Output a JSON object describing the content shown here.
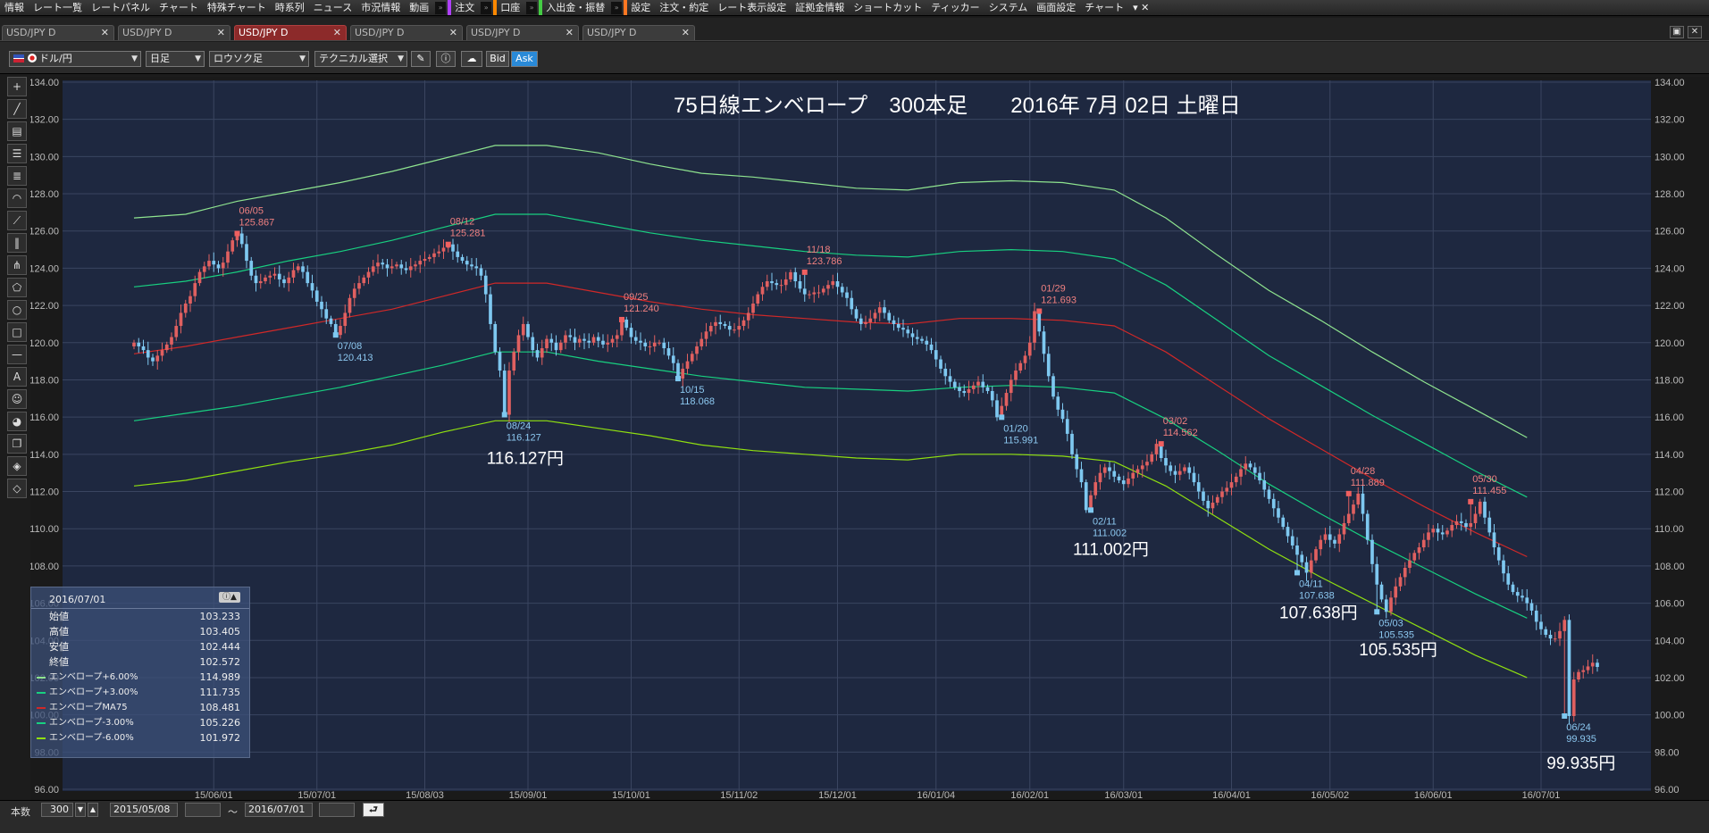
{
  "menu": {
    "items_left": [
      "情報",
      "レート一覧",
      "レートパネル",
      "チャート",
      "特殊チャート",
      "時系列",
      "ニュース",
      "市況情報",
      "動画"
    ],
    "order": "注文",
    "account": "口座",
    "deposit": "入出金・振替",
    "items_right": [
      "設定",
      "注文・約定",
      "レート表示設定",
      "証拠金情報",
      "ショートカット",
      "ティッカー",
      "システム",
      "画面設定",
      "チャート"
    ],
    "colors": {
      "order": "#b040ff",
      "account": "#ff8800",
      "deposit": "#44cc44",
      "settings": "#ff7722"
    }
  },
  "tabs": [
    {
      "label": "USD/JPY D",
      "active": false
    },
    {
      "label": "USD/JPY D",
      "active": false
    },
    {
      "label": "USD/JPY D",
      "active": true
    },
    {
      "label": "USD/JPY D",
      "active": false
    },
    {
      "label": "USD/JPY D",
      "active": false
    },
    {
      "label": "USD/JPY D",
      "active": false
    }
  ],
  "toolbar": {
    "pair": "ドル/円",
    "period": "日足",
    "chart_style": "ロウソク足",
    "technical": "テクニカル選択",
    "bid": "Bid",
    "ask": "Ask"
  },
  "legend": {
    "date": "2016/07/01",
    "ohlc": [
      {
        "label": "始値",
        "value": "103.233"
      },
      {
        "label": "高値",
        "value": "103.405"
      },
      {
        "label": "安値",
        "value": "102.444"
      },
      {
        "label": "終値",
        "value": "102.572"
      }
    ],
    "envelopes": [
      {
        "label": "エンベロープ+6.00%",
        "value": "114.989",
        "color": "#8fe48f"
      },
      {
        "label": "エンベロープ+3.00%",
        "value": "111.735",
        "color": "#18d080"
      },
      {
        "label": "エンベロープMA75",
        "value": "108.481",
        "color": "#d02828"
      },
      {
        "label": "エンベロープ-3.00%",
        "value": "105.226",
        "color": "#18d080"
      },
      {
        "label": "エンベロープ-6.00%",
        "value": "101.972",
        "color": "#90e010"
      }
    ]
  },
  "bottom": {
    "bars_label": "本数",
    "bars_value": "300",
    "from": "2015/05/08",
    "tilde": "～",
    "to": "2016/07/01"
  },
  "chart_data": {
    "type": "candlestick",
    "title": "75日線エンベロープ　300本足　　2016年 7月 02日 土曜日",
    "ylim": [
      96,
      134
    ],
    "y_ticks": [
      "96.00",
      "98.00",
      "100.00",
      "102.00",
      "104.00",
      "106.00",
      "108.00",
      "110.00",
      "112.00",
      "114.00",
      "116.00",
      "118.00",
      "120.00",
      "122.00",
      "124.00",
      "126.00",
      "128.00",
      "130.00",
      "132.00",
      "134.00"
    ],
    "x_ticks": [
      "15/06/01",
      "15/07/01",
      "15/08/03",
      "15/09/01",
      "15/10/01",
      "15/11/02",
      "15/12/01",
      "16/01/04",
      "16/02/01",
      "16/03/01",
      "16/04/01",
      "16/05/02",
      "16/06/01",
      "16/07/01"
    ],
    "x_tick_index": [
      17,
      39,
      62,
      84,
      106,
      129,
      150,
      171,
      191,
      211,
      234,
      255,
      277,
      300
    ],
    "colors": {
      "up": "#e06060",
      "down": "#7ec8f0",
      "high_label": "#f08080",
      "low_label": "#8cc8f0",
      "bg": "#1e2840",
      "grid": "#3a4560"
    },
    "closes": [
      120.0,
      119.8,
      119.6,
      119.2,
      119.0,
      119.3,
      119.6,
      119.9,
      120.3,
      120.9,
      121.6,
      122.1,
      122.5,
      123.2,
      123.8,
      124.1,
      124.4,
      124.2,
      124.0,
      124.3,
      124.9,
      125.5,
      125.867,
      125.3,
      124.4,
      123.6,
      123.2,
      123.3,
      123.5,
      123.6,
      123.7,
      123.4,
      123.2,
      123.5,
      123.9,
      124.1,
      123.8,
      123.2,
      122.8,
      122.2,
      121.8,
      121.3,
      121.0,
      120.413,
      120.9,
      121.6,
      122.4,
      122.9,
      123.2,
      123.5,
      123.8,
      124.1,
      124.3,
      124.2,
      124.0,
      124.1,
      124.2,
      124.0,
      123.9,
      124.1,
      124.2,
      124.4,
      124.5,
      124.6,
      124.8,
      124.9,
      125.1,
      125.281,
      124.9,
      124.6,
      124.4,
      124.2,
      124.1,
      124.0,
      123.6,
      122.6,
      121.0,
      119.5,
      118.5,
      116.127,
      118.5,
      119.5,
      120.4,
      121.0,
      120.3,
      119.6,
      119.2,
      119.7,
      120.2,
      120.0,
      119.6,
      120.0,
      120.4,
      120.3,
      120.0,
      120.2,
      120.1,
      120.0,
      120.3,
      120.1,
      119.9,
      120.0,
      120.2,
      120.4,
      121.24,
      120.8,
      120.3,
      120.1,
      120.0,
      119.8,
      119.8,
      120.0,
      120.0,
      119.7,
      119.3,
      118.9,
      118.068,
      118.6,
      119.0,
      119.4,
      119.8,
      120.2,
      120.6,
      120.9,
      121.1,
      121.0,
      120.9,
      120.7,
      120.7,
      120.9,
      121.2,
      121.6,
      122.1,
      122.6,
      123.0,
      123.3,
      123.2,
      123.1,
      123.1,
      123.4,
      123.786,
      123.3,
      122.9,
      122.6,
      122.6,
      122.7,
      122.7,
      122.9,
      123.1,
      123.3,
      123.0,
      122.7,
      122.4,
      121.8,
      121.3,
      121.0,
      121.1,
      121.3,
      121.6,
      121.9,
      121.6,
      121.2,
      121.0,
      120.8,
      120.7,
      120.5,
      120.3,
      120.2,
      120.1,
      119.9,
      119.6,
      119.1,
      118.6,
      118.2,
      117.9,
      117.6,
      117.4,
      117.3,
      117.5,
      117.7,
      117.9,
      117.6,
      117.4,
      116.9,
      115.991,
      116.6,
      117.3,
      118.0,
      118.5,
      118.9,
      119.3,
      120.0,
      121.693,
      120.6,
      119.4,
      118.2,
      117.1,
      116.4,
      115.9,
      115.1,
      114.0,
      113.2,
      112.5,
      111.002,
      111.8,
      112.5,
      113.0,
      113.3,
      113.1,
      112.8,
      112.6,
      112.4,
      112.7,
      113.0,
      113.2,
      113.4,
      113.6,
      114.0,
      114.562,
      113.8,
      113.4,
      113.1,
      112.9,
      113.1,
      113.3,
      113.0,
      112.5,
      112.0,
      111.5,
      111.1,
      111.4,
      111.7,
      112.0,
      112.2,
      112.5,
      112.8,
      113.2,
      113.5,
      113.3,
      113.0,
      112.6,
      112.1,
      111.6,
      111.1,
      110.6,
      110.1,
      109.6,
      109.1,
      108.6,
      108.2,
      107.638,
      108.3,
      108.9,
      109.4,
      109.7,
      109.4,
      109.2,
      109.7,
      110.3,
      110.8,
      111.3,
      111.889,
      110.8,
      109.4,
      108.1,
      107.0,
      106.2,
      105.535,
      106.3,
      106.9,
      107.4,
      107.9,
      108.3,
      108.7,
      109.0,
      109.4,
      109.8,
      110.0,
      109.8,
      109.7,
      109.9,
      110.2,
      110.4,
      110.3,
      110.1,
      110.3,
      110.8,
      111.455,
      110.6,
      109.8,
      109.0,
      108.3,
      107.6,
      107.0,
      106.6,
      106.4,
      106.3,
      106.0,
      105.6,
      105.0,
      104.6,
      104.3,
      104.1,
      104.1,
      104.5,
      105.1,
      99.935,
      101.9,
      102.3,
      102.4,
      102.6,
      102.8,
      102.572
    ],
    "envelopes": [
      {
        "name": "エンベロープ+6.00%",
        "color": "#8fe48f",
        "values": [
          126.7,
          126.9,
          127.6,
          128.1,
          128.6,
          129.2,
          129.9,
          130.6,
          130.6,
          130.2,
          129.6,
          129.1,
          128.9,
          128.6,
          128.3,
          128.2,
          128.6,
          128.7,
          128.6,
          128.2,
          126.7,
          124.7,
          122.8,
          121.2,
          119.5,
          117.9,
          116.4,
          114.9
        ]
      },
      {
        "name": "エンベロープ+3.00%",
        "color": "#18d080",
        "values": [
          123.0,
          123.3,
          123.8,
          124.4,
          124.9,
          125.5,
          126.2,
          126.9,
          126.9,
          126.4,
          125.9,
          125.5,
          125.2,
          124.9,
          124.7,
          124.6,
          124.9,
          125.0,
          124.9,
          124.5,
          123.1,
          121.2,
          119.3,
          117.7,
          116.1,
          114.6,
          113.1,
          111.7
        ]
      },
      {
        "name": "エンベロープMA75",
        "color": "#d02828",
        "values": [
          119.4,
          119.8,
          120.3,
          120.8,
          121.3,
          121.8,
          122.5,
          123.2,
          123.2,
          122.7,
          122.2,
          121.8,
          121.5,
          121.3,
          121.1,
          121.0,
          121.3,
          121.3,
          121.2,
          120.9,
          119.5,
          117.7,
          115.9,
          114.3,
          112.7,
          111.2,
          109.8,
          108.5
        ]
      },
      {
        "name": "エンベロープ-3.00%",
        "color": "#18d080",
        "values": [
          115.8,
          116.2,
          116.6,
          117.1,
          117.6,
          118.2,
          118.8,
          119.5,
          119.5,
          119.0,
          118.6,
          118.2,
          117.9,
          117.6,
          117.5,
          117.4,
          117.6,
          117.7,
          117.6,
          117.3,
          115.9,
          114.2,
          112.4,
          110.8,
          109.3,
          107.9,
          106.5,
          105.2
        ]
      },
      {
        "name": "エンベロープ-6.00%",
        "color": "#90e010",
        "values": [
          112.3,
          112.6,
          113.1,
          113.6,
          114.0,
          114.5,
          115.2,
          115.8,
          115.8,
          115.4,
          115.0,
          114.5,
          114.2,
          114.0,
          113.8,
          113.7,
          114.0,
          114.0,
          113.9,
          113.6,
          112.3,
          110.6,
          108.9,
          107.4,
          106.0,
          104.6,
          103.2,
          102.0
        ]
      }
    ],
    "envelope_step": 11,
    "annotations": [
      {
        "i": 22,
        "date": "06/05",
        "value": "125.867",
        "kind": "high"
      },
      {
        "i": 43,
        "date": "07/08",
        "value": "120.413",
        "kind": "low"
      },
      {
        "i": 67,
        "date": "08/12",
        "value": "125.281",
        "kind": "high"
      },
      {
        "i": 79,
        "date": "08/24",
        "value": "116.127",
        "kind": "low"
      },
      {
        "i": 104,
        "date": "09/25",
        "value": "121.240",
        "kind": "high"
      },
      {
        "i": 116,
        "date": "10/15",
        "value": "118.068",
        "kind": "low"
      },
      {
        "i": 143,
        "date": "11/18",
        "value": "123.786",
        "kind": "high"
      },
      {
        "i": 185,
        "date": "01/20",
        "value": "115.991",
        "kind": "low"
      },
      {
        "i": 193,
        "date": "01/29",
        "value": "121.693",
        "kind": "high"
      },
      {
        "i": 204,
        "date": "02/11",
        "value": "111.002",
        "kind": "low"
      },
      {
        "i": 219,
        "date": "03/02",
        "value": "114.562",
        "kind": "high"
      },
      {
        "i": 248,
        "date": "04/11",
        "value": "107.638",
        "kind": "low"
      },
      {
        "i": 259,
        "date": "04/28",
        "value": "111.889",
        "kind": "high"
      },
      {
        "i": 265,
        "date": "05/03",
        "value": "105.535",
        "kind": "low"
      },
      {
        "i": 285,
        "date": "05/30",
        "value": "111.455",
        "kind": "high"
      },
      {
        "i": 305,
        "date": "06/24",
        "value": "99.935",
        "kind": "low"
      }
    ],
    "big_labels": [
      {
        "i": 79,
        "y": 113.5,
        "text": "116.127円"
      },
      {
        "i": 204,
        "y": 108.6,
        "text": "111.002円"
      },
      {
        "i": 248,
        "y": 105.2,
        "text": "107.638円"
      },
      {
        "i": 265,
        "y": 103.2,
        "text": "105.535円"
      },
      {
        "i": 305,
        "y": 97.1,
        "text": "99.935円"
      }
    ]
  }
}
